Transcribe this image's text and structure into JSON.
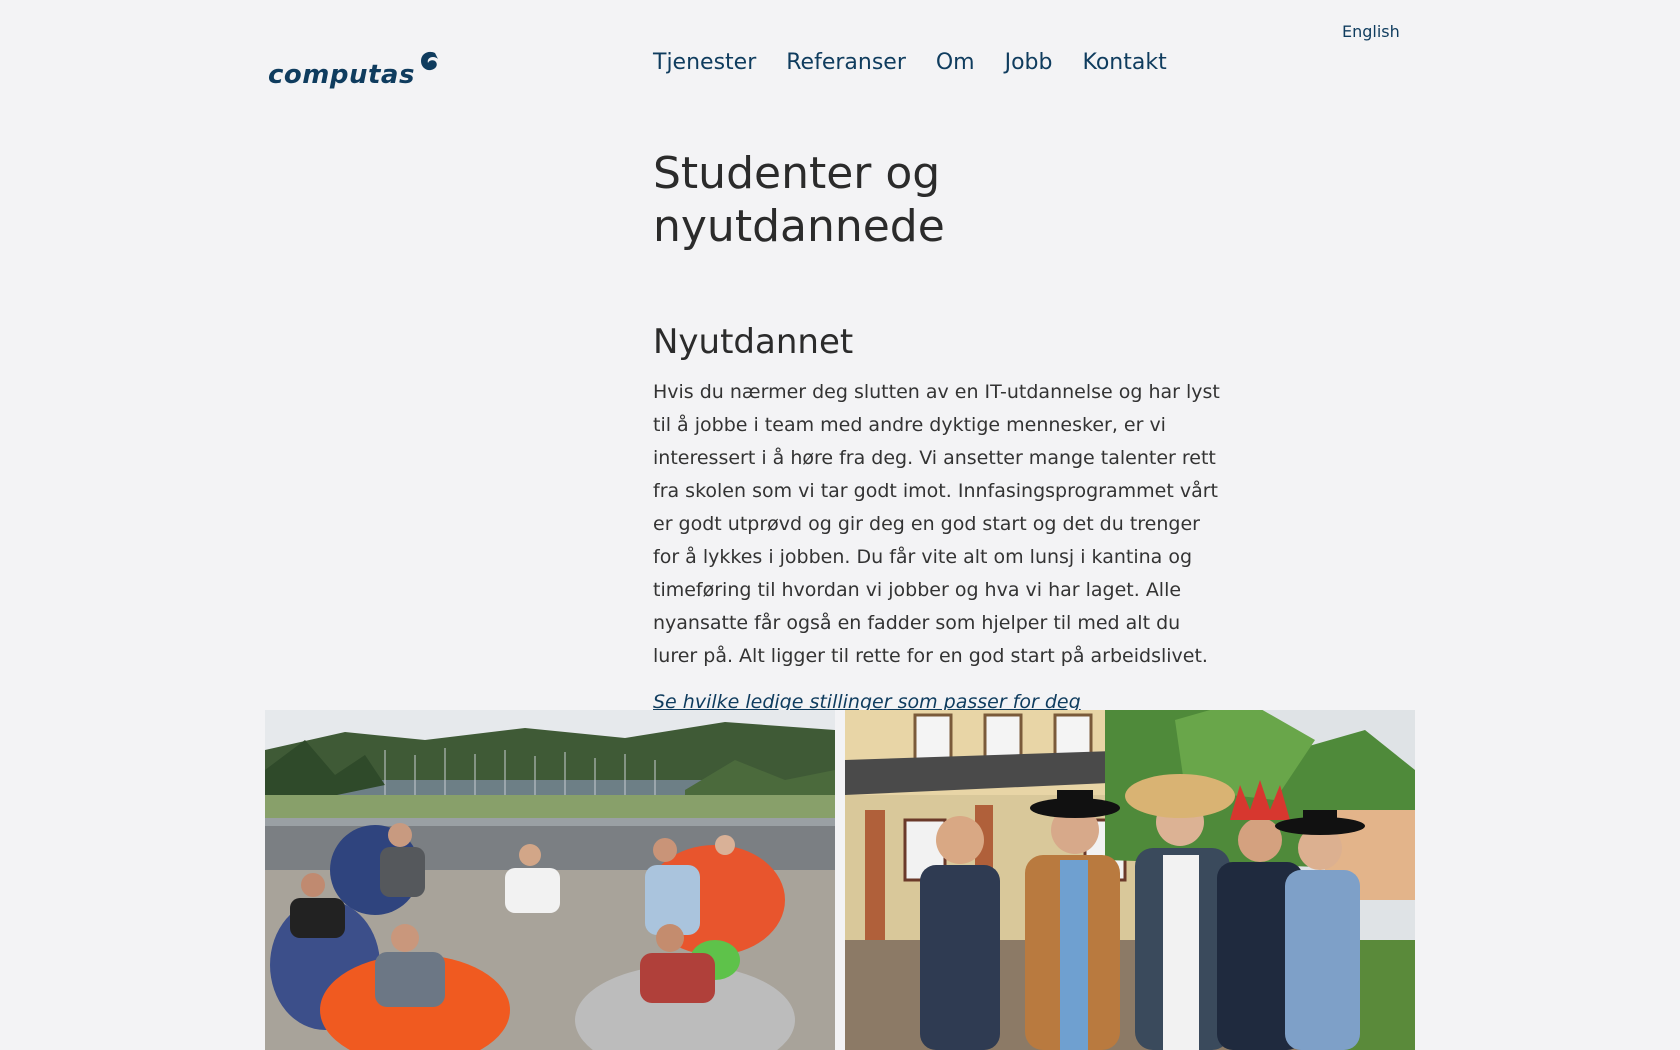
{
  "header": {
    "language_link": "English",
    "logo_text": "computas",
    "nav": [
      {
        "label": "Tjenester"
      },
      {
        "label": "Referanser"
      },
      {
        "label": "Om"
      },
      {
        "label": "Jobb"
      },
      {
        "label": "Kontakt"
      }
    ]
  },
  "main": {
    "page_title": "Studenter og nyutdannede",
    "section_title": "Nyutdannet",
    "paragraph": "Hvis du nærmer deg slutten av en IT-utdannelse og har lyst til å jobbe i team med andre dyktige mennesker, er vi interessert i å høre fra deg. Vi ansetter mange talenter rett fra skolen som vi tar godt imot. Innfasingsprogrammet vårt er godt utprøvd og gir deg en god start og det du trenger for å lykkes i jobben. Du får vite alt om lunsj i kantina og timeføring til hvordan vi jobber og hva vi har laget. Alle nyansatte får også en fadder som hjelper til med alt du lurer på. Alt ligger til rette for en god start på arbeidslivet.",
    "cta_link": "Se hvilke ledige stillinger som passer for deg"
  },
  "colors": {
    "background": "#f3f3f5",
    "brand": "#0f3c5e",
    "text": "#2b2b2b"
  }
}
